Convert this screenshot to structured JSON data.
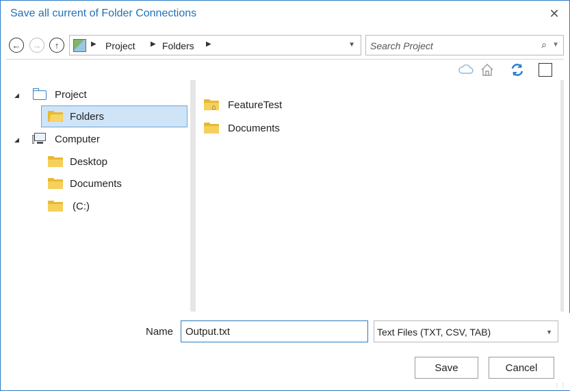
{
  "window": {
    "title": "Save all current of Folder Connections",
    "close_label": "✕"
  },
  "nav": {
    "back_icon": "back-arrow-icon",
    "forward_icon": "forward-arrow-icon",
    "up_icon": "up-arrow-icon",
    "breadcrumb": [
      "Project",
      "Folders"
    ],
    "search_placeholder": "Search Project"
  },
  "toolbar": {
    "icons": [
      "cloud-icon",
      "home-icon",
      "refresh-icon",
      "toggle-view-icon"
    ],
    "refresh_color": "#2a7fcf"
  },
  "tree": {
    "project": "Project",
    "folders": "Folders",
    "computer": "Computer",
    "desktop": "Desktop",
    "documents": "Documents",
    "drive_c": "(C:)"
  },
  "contents": {
    "items": [
      {
        "label": "FeatureTest",
        "icon": "home-folder-icon"
      },
      {
        "label": "Documents",
        "icon": "folder-icon"
      }
    ]
  },
  "footer": {
    "name_label": "Name",
    "name_value": "Output.txt",
    "file_type": "Text Files (TXT, CSV, TAB)",
    "save_label": "Save",
    "cancel_label": "Cancel"
  },
  "colors": {
    "accent": "#2470b3",
    "selection_bg": "#cfe4f7",
    "folder": "#e8b92e"
  }
}
